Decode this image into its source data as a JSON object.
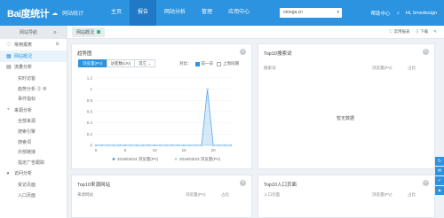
{
  "header": {
    "logo": "Bai度统计",
    "logo_cloud": "☁",
    "logo_sub": "网站统计",
    "nav": [
      "主页",
      "报告",
      "网站分析",
      "管理",
      "应用中心"
    ],
    "site_value": "omega.cn",
    "help": "帮助中心",
    "notice": "⌂",
    "user": "Hi, bmedesign"
  },
  "sidebar": {
    "head_label": "网站导航",
    "items": [
      {
        "label": "常用报表",
        "icon": "♡",
        "type": "section"
      },
      {
        "label": "网站概况",
        "icon": "▦",
        "type": "section",
        "active": true
      },
      {
        "label": "流量分析",
        "icon": "▤",
        "type": "section"
      },
      {
        "label": "实时访客",
        "type": "sub"
      },
      {
        "label": "趋势分析 ⑤ ⊕",
        "type": "sub"
      },
      {
        "label": "事件指标",
        "type": "sub"
      },
      {
        "label": "来源分析",
        "icon": "◔",
        "type": "section"
      },
      {
        "label": "全部来源",
        "type": "sub"
      },
      {
        "label": "搜索引擎",
        "type": "sub"
      },
      {
        "label": "搜索词",
        "type": "sub"
      },
      {
        "label": "外部链接",
        "type": "sub"
      },
      {
        "label": "指定广告跟踪",
        "type": "sub"
      },
      {
        "label": "访问分析",
        "icon": "◕",
        "type": "section"
      },
      {
        "label": "受访页面",
        "type": "sub"
      },
      {
        "label": "入口页面",
        "type": "sub"
      }
    ]
  },
  "content_head": {
    "tag": "网站概况",
    "right_links": [
      "♡ 常用报表",
      "⇩ 下载",
      "✎"
    ]
  },
  "trend_panel": {
    "title": "趋势图",
    "buttons": [
      "浏览量(PV)",
      "访客数(UV)",
      "其它 ⌄"
    ],
    "compare_label": "对比：",
    "compare_opts": [
      "前一日",
      "上周同期"
    ],
    "legend": [
      "2018/03/24 浏览量(PV)",
      "2018/03/23 浏览量(PV)"
    ]
  },
  "top10_search": {
    "title": "Top10搜索词",
    "col1": "搜索词",
    "col2": "浏览量(PV)",
    "col3": "占比",
    "empty": "暂无数据"
  },
  "top10_source": {
    "title": "Top10来源网站",
    "col1": "来源网站",
    "col2": "浏览量(PV)",
    "col3": "占比"
  },
  "top10_entry": {
    "title": "Top10入口页面",
    "col1": "入口页面",
    "col2": "浏览量(PV)",
    "col3": "占比"
  },
  "chart_data": {
    "type": "line",
    "x": [
      0,
      1,
      2,
      3,
      4,
      5,
      6,
      7,
      8,
      9,
      10,
      11,
      12,
      13,
      14,
      15,
      16,
      17,
      18,
      19,
      20,
      21,
      22,
      23
    ],
    "series": [
      {
        "name": "2018/03/24 浏览量(PV)",
        "values": [
          0,
          0,
          0,
          0,
          0,
          0,
          0,
          0,
          0,
          0,
          0,
          0,
          0,
          0,
          0,
          0,
          0,
          0,
          0,
          1,
          0,
          0,
          0,
          0
        ],
        "color": "#5aa6e6"
      },
      {
        "name": "2018/03/23 浏览量(PV)",
        "values": [
          0,
          0,
          0,
          0,
          0,
          0,
          0,
          0,
          0,
          0,
          0,
          0,
          0,
          0,
          0,
          0,
          0,
          0,
          0,
          0,
          0,
          0,
          0,
          0
        ],
        "color": "#b7e3d3"
      }
    ],
    "xticks": [
      0,
      5,
      10,
      15,
      20
    ],
    "yticks": [
      0,
      0.2,
      0.4,
      0.6,
      0.8,
      1,
      1.2
    ],
    "ylim": [
      0,
      1.2
    ],
    "xlim": [
      0,
      23
    ]
  }
}
